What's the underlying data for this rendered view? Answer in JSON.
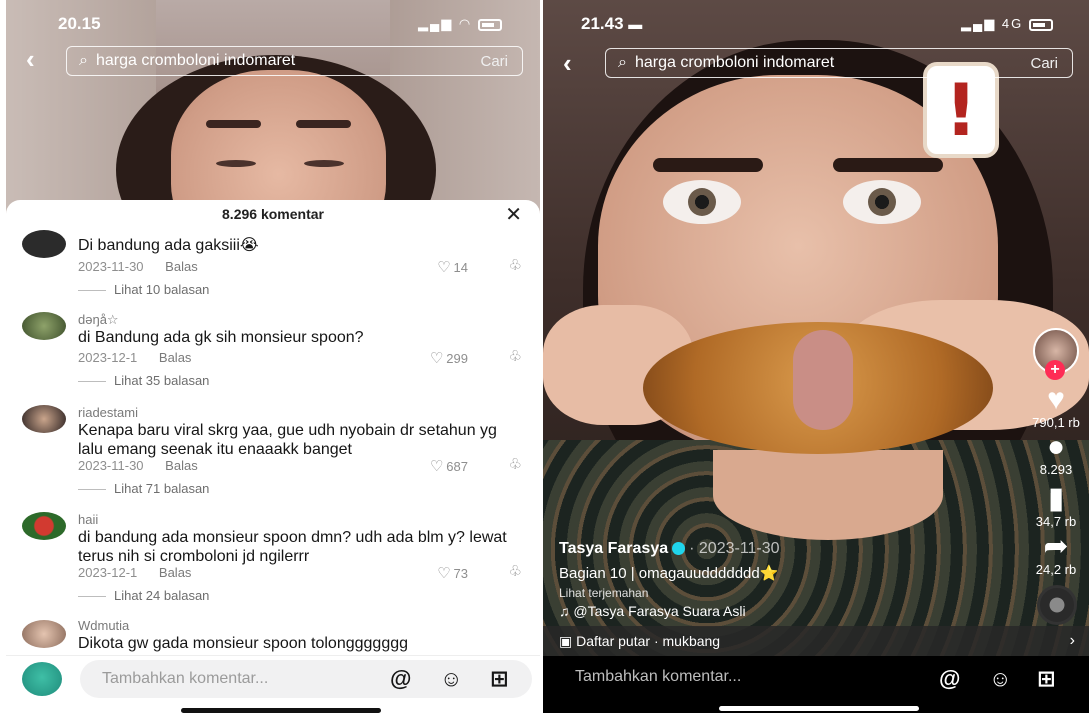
{
  "left": {
    "status_time": "20.15",
    "search_query": "harga cromboloni indomaret",
    "search_button": "Cari",
    "comment_count_title": "8.296 komentar",
    "comments": [
      {
        "user": "",
        "text": "Di bandung ada gaksiii😭",
        "date": "2023-11-30",
        "reply": "Balas",
        "likes": "14",
        "more": "Lihat 10 balasan"
      },
      {
        "user": "dəŋå☆",
        "text": "di Bandung ada gk sih monsieur spoon?",
        "date": "2023-12-1",
        "reply": "Balas",
        "likes": "299",
        "more": "Lihat 35 balasan"
      },
      {
        "user": "riadestami",
        "text": "Kenapa baru viral skrg yaa, gue udh nyobain dr setahun yg lalu emang seenak itu enaaakk banget",
        "date": "2023-11-30",
        "reply": "Balas",
        "likes": "687",
        "more": "Lihat 71 balasan"
      },
      {
        "user": "haii",
        "text": "di bandung ada monsieur spoon dmn? udh ada blm y? lewat terus nih si cromboloni jd ngilerrr",
        "date": "2023-12-1",
        "reply": "Balas",
        "likes": "73",
        "more": "Lihat 24 balasan"
      },
      {
        "user": "Wdmutia",
        "text": "Dikota gw gada monsieur spoon tolonggggggg"
      }
    ],
    "input_placeholder": "Tambahkan komentar..."
  },
  "right": {
    "status_time": "21.43",
    "network": "4G",
    "search_query": "harga cromboloni indomaret",
    "search_button": "Cari",
    "likes": "790,1 rb",
    "comments": "8.293",
    "saves": "34,7 rb",
    "shares": "24,2 rb",
    "author": "Tasya Farasya",
    "date": "· 2023-11-30",
    "caption": "Bagian 10 | omagauuddddddd⭐",
    "translate": "Lihat terjemahan",
    "sound": "♫ @Tasya Farasya Suara Asli",
    "playlist": "Daftar putar · mukbang",
    "input_placeholder": "Tambahkan komentar..."
  },
  "colors": {
    "accent_red": "#fe2c55",
    "verified": "#20d5ec"
  }
}
